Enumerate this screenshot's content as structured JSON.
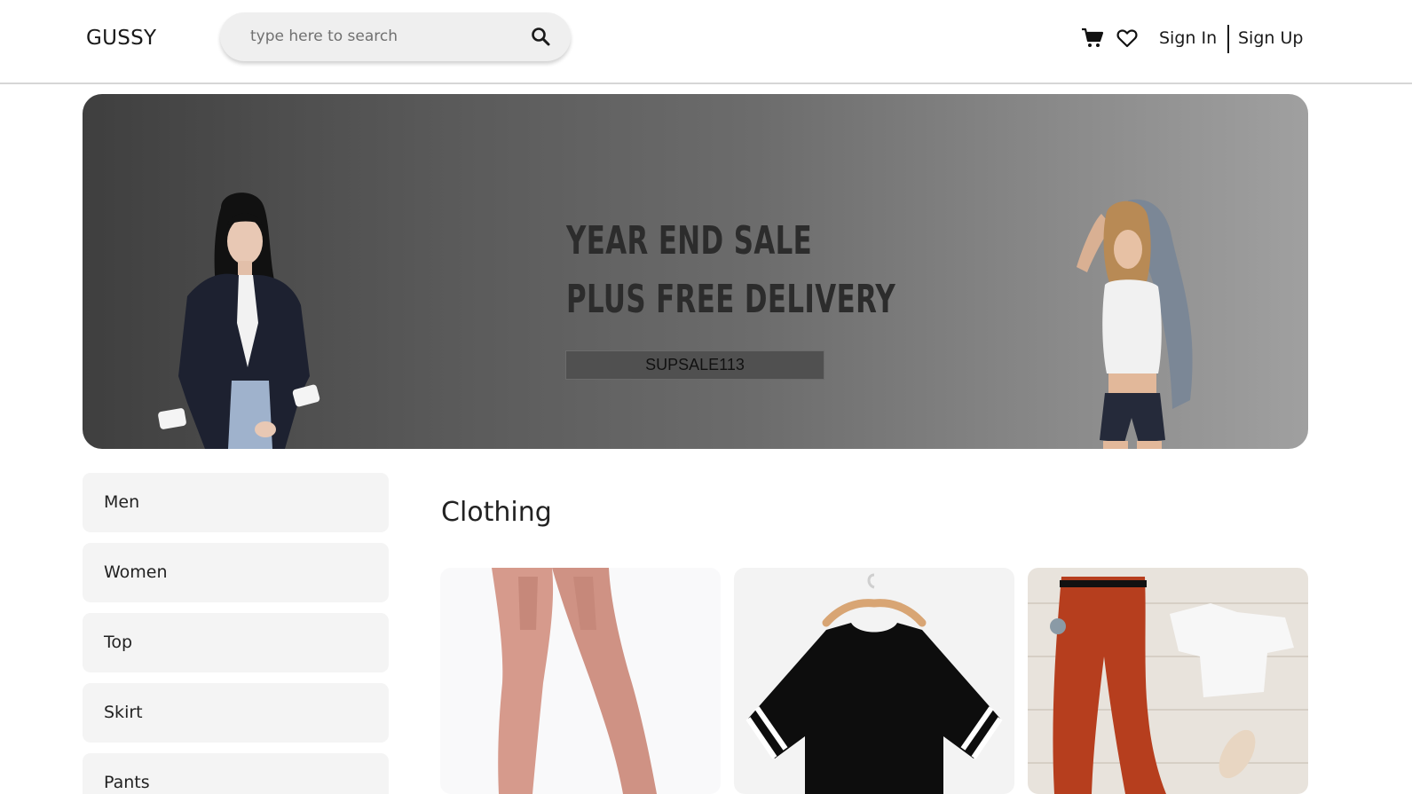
{
  "header": {
    "logo": "GUSSY",
    "search_placeholder": "type here to search",
    "search_value": "",
    "icons": [
      "search-icon",
      "cart-icon",
      "heart-icon"
    ],
    "sign_in": "Sign In",
    "sign_up": "Sign Up"
  },
  "banner": {
    "headline": "YEAR END SALE",
    "subheadline": "PLUS FREE DELIVERY",
    "coupon_code": "SUPSALE113"
  },
  "sidebar": {
    "categories": [
      {
        "label": "Men"
      },
      {
        "label": "Women"
      },
      {
        "label": "Top"
      },
      {
        "label": "Skirt"
      },
      {
        "label": "Pants"
      }
    ]
  },
  "main": {
    "section_title": "Clothing",
    "products": [
      {
        "image": "pink-jogger-pants"
      },
      {
        "image": "black-striped-tshirt"
      },
      {
        "image": "orange-pants-white-top-outfit"
      }
    ]
  },
  "colors": {
    "banner_dark": "#3f3f3f",
    "banner_light": "#a0a0a0",
    "card_bg": "#f4f4f4",
    "search_bg": "#efefef"
  }
}
